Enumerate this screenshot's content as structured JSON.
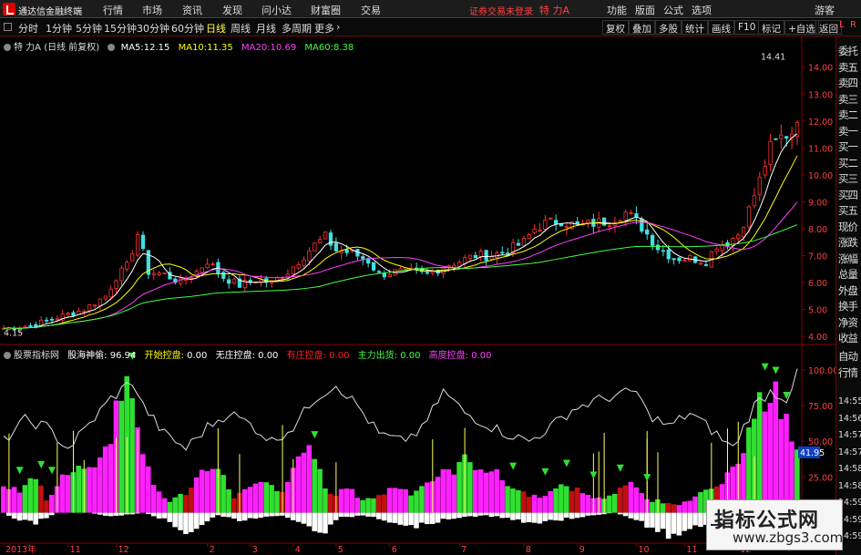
{
  "app": {
    "brand": "通达信金融终端",
    "menu": [
      "行情",
      "市场",
      "资讯",
      "发现",
      "问小达",
      "财富圈",
      "交易"
    ],
    "login_status": "证券交易未登录",
    "stock_name": "特 力A",
    "right_menu": [
      "功能",
      "版面",
      "公式",
      "选项"
    ],
    "guest": "游客"
  },
  "toolbar": {
    "periods": [
      "分时",
      "1分钟",
      "5分钟",
      "15分钟",
      "30分钟",
      "60分钟",
      "日线",
      "周线",
      "月线",
      "多周期",
      "更多"
    ],
    "active_period": "日线",
    "right_buttons": [
      "复权",
      "叠加",
      "多股",
      "统计",
      "画线",
      "F10",
      "标记",
      "+自选",
      "返回"
    ]
  },
  "legend_main": {
    "title": "特 力A (日线 前复权)",
    "items": [
      {
        "label": "MA5:",
        "value": "12.15",
        "color": "#ffffff"
      },
      {
        "label": "MA10:",
        "value": "11.35",
        "color": "#ffff00"
      },
      {
        "label": "MA20:",
        "value": "10.69",
        "color": "#ff40ff"
      },
      {
        "label": "MA60:",
        "value": "8.38",
        "color": "#40ff40"
      }
    ]
  },
  "legend_indicator": {
    "source": "股票指标网",
    "items": [
      {
        "label": "股海神偷:",
        "value": "96.94",
        "color": "#ffffff",
        "vcolor": "#ffffff"
      },
      {
        "label": "开始控盘:",
        "value": "0.00",
        "color": "#ffff00",
        "vcolor": "#ffffff"
      },
      {
        "label": "无庄控盘:",
        "value": "0.00",
        "color": "#ffffff",
        "vcolor": "#ffffff"
      },
      {
        "label": "有庄控盘:",
        "value": "0.00",
        "color": "#ff2020",
        "vcolor": "#ff2020"
      },
      {
        "label": "主力出货:",
        "value": "0.00",
        "color": "#40ff40",
        "vcolor": "#40ff40"
      },
      {
        "label": "高度控盘:",
        "value": "0.00",
        "color": "#ff40ff",
        "vcolor": "#ff40ff"
      }
    ]
  },
  "right_panel": {
    "top_marks": [
      "L",
      "R"
    ],
    "items": [
      "委托",
      "卖五",
      "卖四",
      "卖三",
      "卖二",
      "卖一",
      "买一",
      "买二",
      "买三",
      "买四",
      "买五",
      "现价",
      "涨跌",
      "涨幅",
      "总量",
      "外盘",
      "换手",
      "净资",
      "收益",
      "自动",
      "行情",
      "14:55",
      "14:56",
      "14:57",
      "14:57",
      "14:58",
      "14:58",
      "14:59",
      "14:59",
      "14:59"
    ]
  },
  "watermark": {
    "title": "指标公式网",
    "url": "www.zbgs3.com"
  },
  "chart_data": [
    {
      "type": "candlestick",
      "title": "特 力A (日线 前复权)",
      "y_ticks": [
        4.0,
        5.0,
        6.0,
        7.0,
        8.0,
        9.0,
        10.0,
        11.0,
        12.0,
        13.0,
        14.0
      ],
      "ylim": [
        3.7,
        14.6
      ],
      "annotations": [
        {
          "text": "4.15",
          "x": 0,
          "y": 4.15
        },
        {
          "text": "14.41",
          "x": 148,
          "y": 14.41
        }
      ],
      "x_labels": [
        "2013年",
        "11",
        "12",
        "2",
        "3",
        "4",
        "5",
        "6",
        "7",
        "8",
        "9",
        "10",
        "11",
        "12"
      ],
      "x_label_index": [
        0,
        12,
        21,
        38,
        46,
        54,
        62,
        72,
        85,
        97,
        107,
        118,
        127,
        137
      ],
      "close_anchors": [
        [
          0,
          4.3
        ],
        [
          5,
          4.4
        ],
        [
          10,
          4.7
        ],
        [
          15,
          5.0
        ],
        [
          19,
          5.5
        ],
        [
          21,
          6.2
        ],
        [
          23,
          6.6
        ],
        [
          25,
          7.8
        ],
        [
          27,
          6.4
        ],
        [
          30,
          6.3
        ],
        [
          33,
          6.0
        ],
        [
          36,
          6.4
        ],
        [
          38,
          6.8
        ],
        [
          41,
          6.2
        ],
        [
          44,
          5.9
        ],
        [
          47,
          6.1
        ],
        [
          50,
          6.0
        ],
        [
          53,
          6.4
        ],
        [
          56,
          7.0
        ],
        [
          58,
          7.4
        ],
        [
          60,
          7.7
        ],
        [
          62,
          7.2
        ],
        [
          65,
          7.1
        ],
        [
          68,
          6.8
        ],
        [
          70,
          6.3
        ],
        [
          73,
          6.4
        ],
        [
          76,
          6.4
        ],
        [
          79,
          6.3
        ],
        [
          82,
          6.6
        ],
        [
          85,
          6.8
        ],
        [
          88,
          7.0
        ],
        [
          91,
          7.0
        ],
        [
          94,
          7.2
        ],
        [
          97,
          7.5
        ],
        [
          99,
          8.0
        ],
        [
          101,
          8.2
        ],
        [
          104,
          8.3
        ],
        [
          107,
          8.1
        ],
        [
          110,
          8.2
        ],
        [
          113,
          8.3
        ],
        [
          116,
          8.6
        ],
        [
          118,
          8.3
        ],
        [
          120,
          7.8
        ],
        [
          122,
          7.3
        ],
        [
          125,
          6.9
        ],
        [
          128,
          6.9
        ],
        [
          131,
          6.8
        ],
        [
          133,
          7.4
        ],
        [
          135,
          7.5
        ],
        [
          137,
          7.8
        ],
        [
          139,
          8.7
        ],
        [
          141,
          9.8
        ],
        [
          143,
          11.0
        ],
        [
          145,
          11.4
        ],
        [
          147,
          11.6
        ],
        [
          148,
          12.2
        ]
      ],
      "series": [
        {
          "name": "MA5",
          "value": 12.15,
          "color": "#ffffff"
        },
        {
          "name": "MA10",
          "value": 11.35,
          "color": "#ffff00"
        },
        {
          "name": "MA20",
          "value": 10.69,
          "color": "#ff40ff"
        },
        {
          "name": "MA60",
          "value": 8.38,
          "color": "#40ff40"
        }
      ]
    },
    {
      "type": "bar",
      "title": "股票指标网",
      "y_ticks": [
        25.0,
        50.0,
        75.0,
        100.0
      ],
      "ylim": [
        -20,
        105
      ],
      "highlight_value": "41.95",
      "line_anchors": [
        [
          0,
          50
        ],
        [
          4,
          65
        ],
        [
          8,
          60
        ],
        [
          12,
          45
        ],
        [
          16,
          62
        ],
        [
          20,
          80
        ],
        [
          24,
          92
        ],
        [
          26,
          75
        ],
        [
          30,
          55
        ],
        [
          34,
          45
        ],
        [
          38,
          60
        ],
        [
          42,
          70
        ],
        [
          46,
          62
        ],
        [
          50,
          50
        ],
        [
          54,
          60
        ],
        [
          58,
          80
        ],
        [
          62,
          90
        ],
        [
          66,
          75
        ],
        [
          70,
          55
        ],
        [
          74,
          50
        ],
        [
          78,
          58
        ],
        [
          82,
          85
        ],
        [
          86,
          70
        ],
        [
          90,
          62
        ],
        [
          94,
          55
        ],
        [
          98,
          50
        ],
        [
          102,
          60
        ],
        [
          106,
          72
        ],
        [
          110,
          78
        ],
        [
          114,
          82
        ],
        [
          118,
          85
        ],
        [
          120,
          70
        ],
        [
          124,
          60
        ],
        [
          128,
          70
        ],
        [
          132,
          58
        ],
        [
          136,
          45
        ],
        [
          140,
          75
        ],
        [
          143,
          85
        ],
        [
          146,
          80
        ],
        [
          148,
          97
        ]
      ],
      "bar_anchors": [
        [
          0,
          22
        ],
        [
          3,
          15
        ],
        [
          6,
          28
        ],
        [
          8,
          10
        ],
        [
          11,
          25
        ],
        [
          14,
          32
        ],
        [
          17,
          38
        ],
        [
          20,
          60
        ],
        [
          22,
          85
        ],
        [
          24,
          95
        ],
        [
          26,
          50
        ],
        [
          28,
          20
        ],
        [
          31,
          8
        ],
        [
          34,
          15
        ],
        [
          37,
          30
        ],
        [
          39,
          38
        ],
        [
          41,
          25
        ],
        [
          43,
          12
        ],
        [
          46,
          18
        ],
        [
          49,
          22
        ],
        [
          51,
          15
        ],
        [
          53,
          20
        ],
        [
          55,
          40
        ],
        [
          57,
          50
        ],
        [
          59,
          30
        ],
        [
          61,
          12
        ],
        [
          64,
          18
        ],
        [
          67,
          10
        ],
        [
          70,
          12
        ],
        [
          73,
          20
        ],
        [
          76,
          15
        ],
        [
          80,
          25
        ],
        [
          83,
          30
        ],
        [
          86,
          38
        ],
        [
          89,
          35
        ],
        [
          92,
          28
        ],
        [
          95,
          18
        ],
        [
          99,
          12
        ],
        [
          102,
          15
        ],
        [
          105,
          20
        ],
        [
          108,
          15
        ],
        [
          111,
          10
        ],
        [
          114,
          15
        ],
        [
          117,
          20
        ],
        [
          120,
          10
        ],
        [
          123,
          8
        ],
        [
          126,
          5
        ],
        [
          129,
          12
        ],
        [
          131,
          20
        ],
        [
          134,
          22
        ],
        [
          137,
          35
        ],
        [
          139,
          55
        ],
        [
          141,
          80
        ],
        [
          143,
          95
        ],
        [
          145,
          75
        ],
        [
          147,
          60
        ],
        [
          148,
          55
        ]
      ],
      "negative_anchors": [
        [
          0,
          0
        ],
        [
          3,
          -6
        ],
        [
          6,
          -8
        ],
        [
          10,
          0
        ],
        [
          16,
          0
        ],
        [
          20,
          -3
        ],
        [
          26,
          0
        ],
        [
          30,
          -5
        ],
        [
          34,
          -15
        ],
        [
          37,
          -8
        ],
        [
          40,
          -2
        ],
        [
          44,
          -6
        ],
        [
          48,
          -4
        ],
        [
          52,
          -2
        ],
        [
          56,
          -10
        ],
        [
          60,
          -14
        ],
        [
          63,
          -4
        ],
        [
          67,
          -2
        ],
        [
          71,
          -6
        ],
        [
          75,
          -12
        ],
        [
          79,
          -8
        ],
        [
          84,
          -4
        ],
        [
          90,
          -2
        ],
        [
          96,
          -6
        ],
        [
          100,
          -8
        ],
        [
          106,
          -4
        ],
        [
          110,
          -2
        ],
        [
          114,
          0
        ],
        [
          118,
          -5
        ],
        [
          122,
          -14
        ],
        [
          124,
          -18
        ],
        [
          126,
          -20
        ],
        [
          128,
          -15
        ],
        [
          130,
          -10
        ],
        [
          132,
          -6
        ],
        [
          135,
          -3
        ],
        [
          138,
          0
        ],
        [
          148,
          0
        ]
      ],
      "arrow_index": [
        3,
        7,
        9,
        24,
        58,
        95,
        101,
        105,
        110,
        115,
        120,
        142,
        144,
        146
      ]
    }
  ]
}
